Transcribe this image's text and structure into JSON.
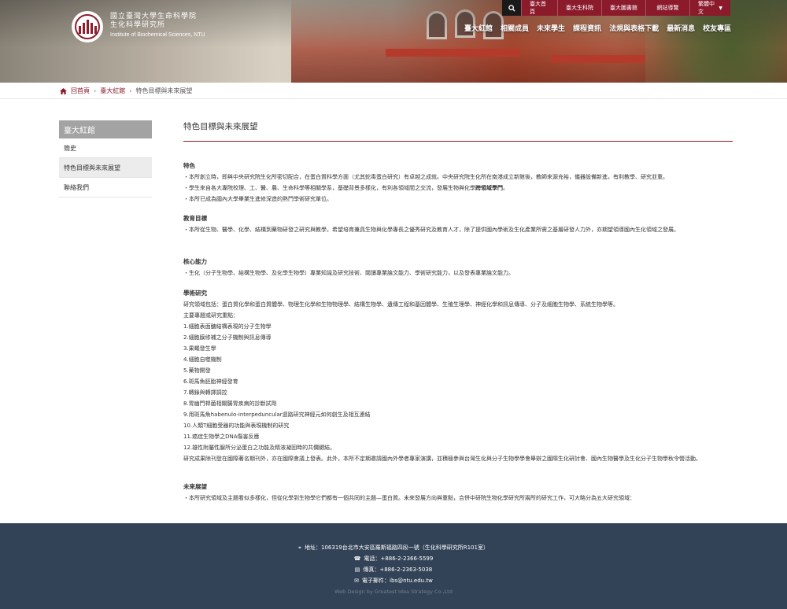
{
  "header": {
    "logo_cn_line1": "國立臺灣大學生命科學院",
    "logo_cn_line2": "生化科學研究所",
    "logo_en": "Institute of Biochemical Sciences, NTU",
    "topbar": [
      "臺大首頁",
      "臺大生科院",
      "臺大圖書館",
      "網站導覽",
      "繁體中文"
    ],
    "mainnav": [
      "臺大紅館",
      "相關成員",
      "未來學生",
      "課程資訊",
      "法規與表格下載",
      "最新消息",
      "校友專區"
    ]
  },
  "breadcrumb": {
    "home": "回首頁",
    "parent": "臺大紅館",
    "current": "特色目標與未來展望"
  },
  "sidebar": {
    "title": "臺大紅館",
    "items": [
      "簡史",
      "特色目標與未來展望",
      "聯絡我們"
    ]
  },
  "page": {
    "title": "特色目標與未來展望"
  },
  "sections": {
    "features": {
      "heading": "特色",
      "l1": "・本所創立時，即與中央研究院生化所密切配合，在蛋白質科學方面（尤其蛇毒蛋白研究）有卓越之成就。中央研究院生化所在南港成立新館後，教師來源充裕，儀器設備新進，有利教學、研究並重。",
      "l2a": "・學生來自各大專院校理、工、醫、農、生命科學等相關學系，基礎背景多樣化，有利各領域間之交流，發展生物與化學",
      "l2b": "跨領域學門",
      "l2c": "。",
      "l3": "・本所已成為國內大學畢業生進修深造的熱門學術研究單位。"
    },
    "goals": {
      "heading": "教育目標",
      "l1": "・本所從生物、醫學、化學、結構到藥物研發之研究與教學，希望培育兼具生物與化學專長之優秀研究及教育人才，除了提供國內學術及生化產業所需之基層研發人力外，亦期望領導國內生化領域之發展。"
    },
    "core": {
      "heading": "核心能力",
      "l1": "・生化（分子生物學、結構生物學、及化學生物學）專業知識及研究技術、閱讀專業論文能力、學術研究能力，以及發表專業論文能力。"
    },
    "research": {
      "heading": "學術研究",
      "l1": "研究領域包括：蛋白質化學和蛋白質體學、物理生化學和生物物理學、結構生物學、遺傳工程和基因體學、生殖生理學、神經化學和訊息傳導、分子及細胞生物學、系統生物學等。",
      "l2": "主要專題或研究重點：",
      "items": [
        "1.細胞表面醣結構表現的分子生物學",
        "2.細胞膜修補之分子機制與訊息傳導",
        "3.果蠅發生學",
        "4.細胞自噬機制",
        "5.藥物開發",
        "6.斑馬魚胚胎神經發育",
        "7.轉錄與轉譯調控",
        "8.胃幽門桿菌相關腸胃疾病的診斷試劑",
        "9.用斑馬魚habenulo-interpeduncular迴路研究神經元如何創生及相互連結",
        "10.人類T細胞受器的功能與表現機制的研究",
        "11.癌症生物學之DNA傷害反應",
        "12.雄性附屬性腺所分泌蛋白之功能及精液凝固時的共價鍵結。"
      ],
      "l3": "研究成果除刊登在國際著名期刊外，亦在國際會議上發表。此外，本所不定期邀請國內外學者專家演講，並積極參與台灣生化與分子生物學學會舉辦之國際生化研討會、國內生物醫學及生化分子生物學秋令營活動。"
    },
    "future": {
      "heading": "未來展望",
      "l1": "・本所研究領域及主題看似多樣化，但從化學到生物學它們都有一個共同的主題—蛋白質。未來發展方向與重點，合併中研院生物化學研究所兩所的研究工作，可大略分為五大研究領域："
    }
  },
  "footer": {
    "address": "地址：106319台北市大安區羅斯福路四段一號（生化科學研究所R101室）",
    "phone": "電話：+886-2-2366-5599",
    "fax": "傳真：+886-2-2363-5038",
    "email": "電子郵件：ibs@ntu.edu.tw",
    "credit": "Web Design by Greatest Idea Strategy Co.,Ltd"
  },
  "colors": {
    "brand": "#8b1a2b",
    "footer_bg": "#334357",
    "sidebar_head": "#a3a3a3"
  }
}
